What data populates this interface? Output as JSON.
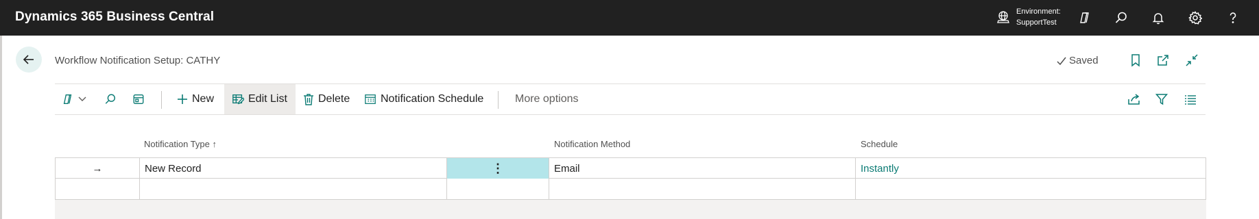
{
  "appbar": {
    "title": "Dynamics 365 Business Central",
    "environment_label": "Environment:",
    "environment_name": "SupportTest",
    "icons": [
      "environment-icon",
      "copilot-icon",
      "search-icon",
      "bell-icon",
      "gear-icon",
      "help-icon"
    ]
  },
  "header": {
    "title": "Workflow Notification Setup: CATHY",
    "status": "Saved",
    "icons": [
      "back-arrow-icon",
      "bookmark-icon",
      "open-new-window-icon",
      "collapse-icon"
    ]
  },
  "actions": {
    "new": "New",
    "edit_list": "Edit List",
    "delete": "Delete",
    "notification_schedule": "Notification Schedule",
    "more_options": "More options"
  },
  "grid": {
    "columns": [
      "Notification Type",
      "Notification Method",
      "Schedule"
    ],
    "sort_indicator": "↑",
    "rows": [
      {
        "notification_type": "New Record",
        "notification_method": "Email",
        "schedule": "Instantly",
        "row_menu": "⋮",
        "selector": "→"
      },
      {
        "notification_type": "",
        "notification_method": "",
        "schedule": ""
      }
    ]
  },
  "colors": {
    "appbar_bg": "#212121",
    "accent": "#0b7b74",
    "selected_cell": "#b3e5ea"
  }
}
